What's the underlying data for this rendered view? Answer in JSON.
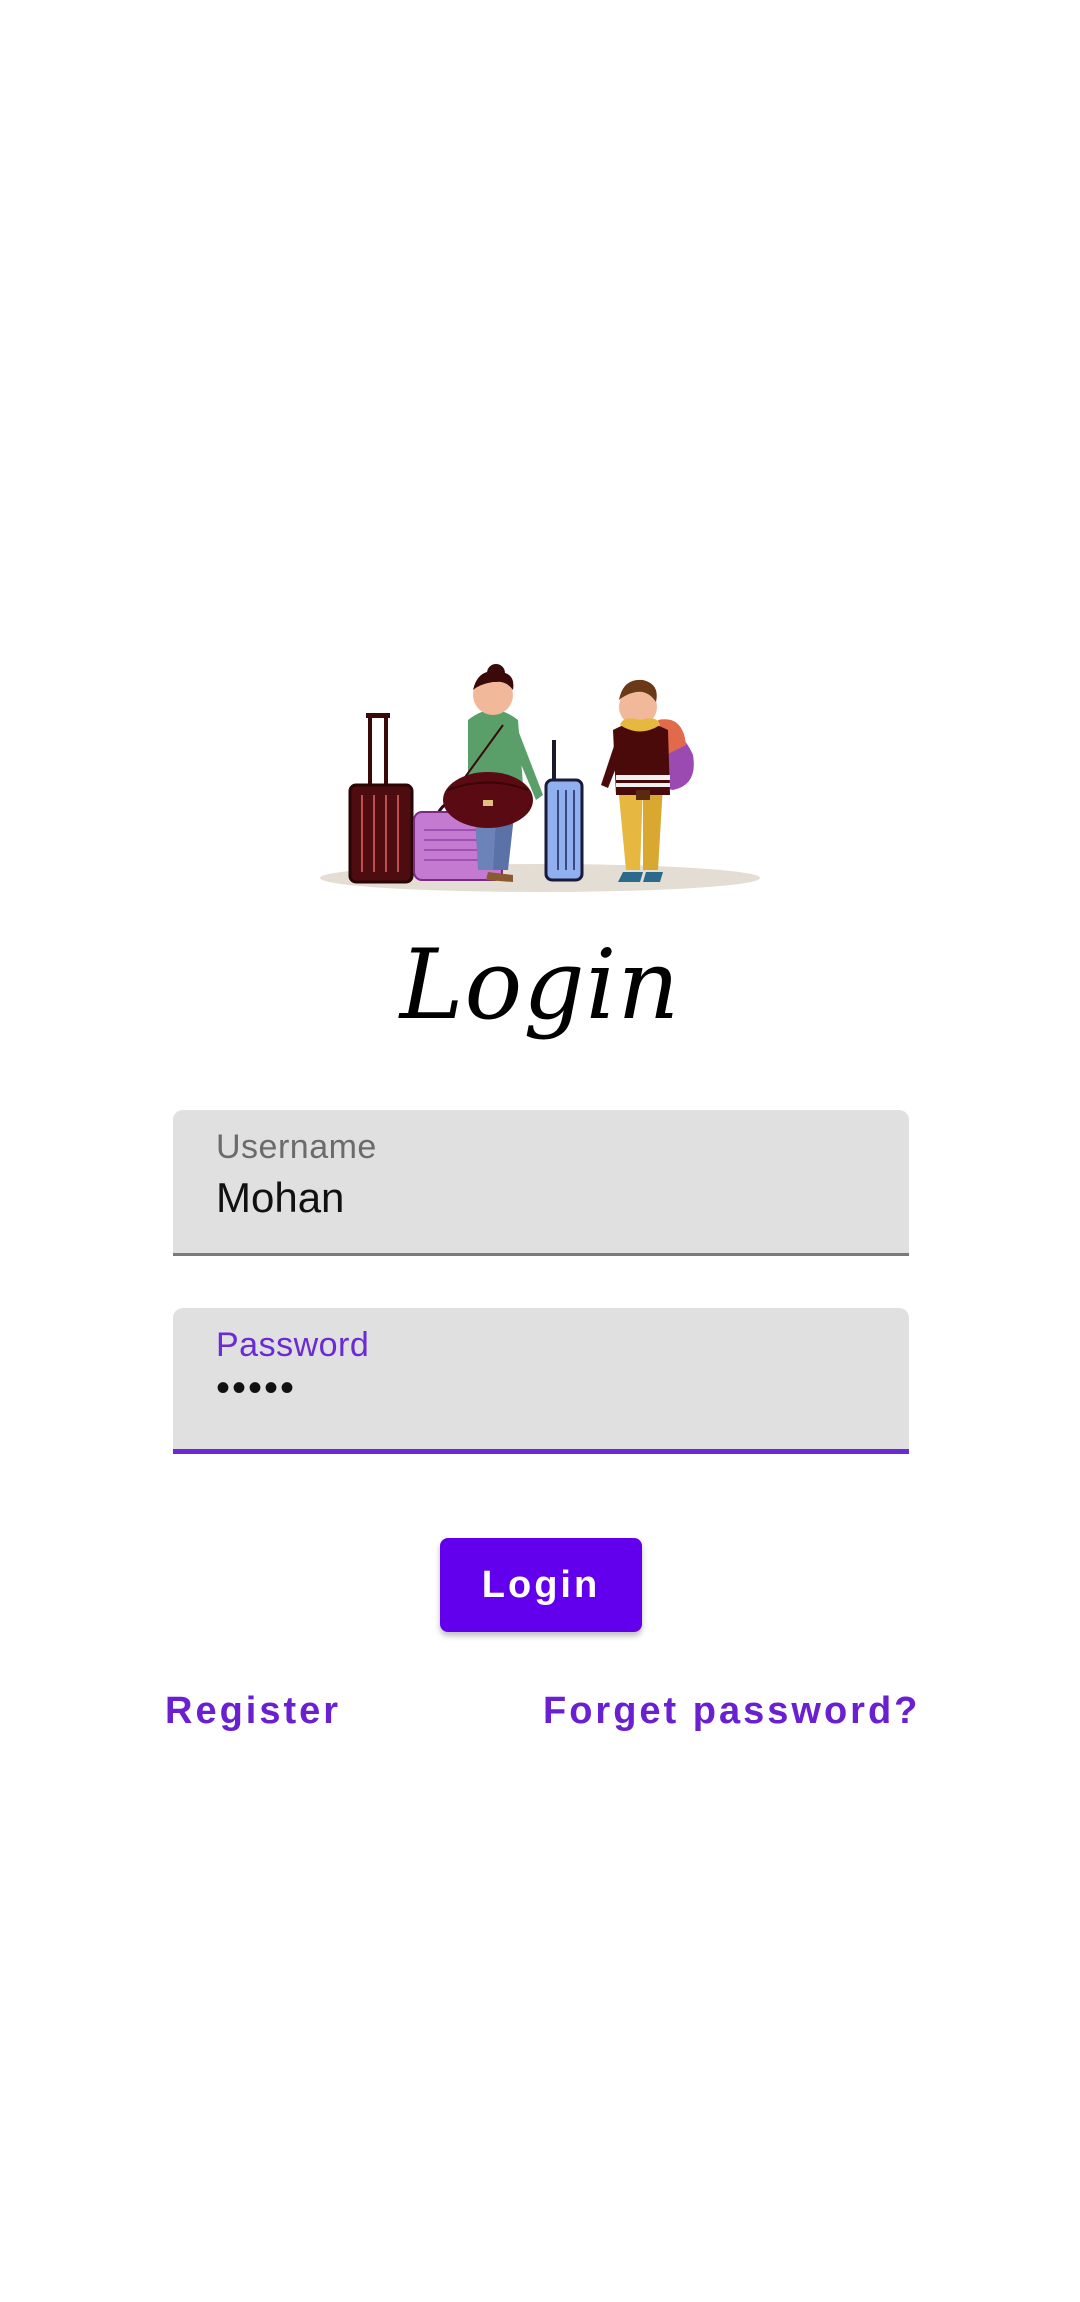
{
  "screen": {
    "title": "Login"
  },
  "form": {
    "username": {
      "label": "Username",
      "value": "Mohan"
    },
    "password": {
      "label": "Password",
      "value": "•••••"
    }
  },
  "actions": {
    "login_label": "Login",
    "register_label": "Register",
    "forgot_label": "Forget password?"
  },
  "colors": {
    "accent": "#6200ee",
    "link": "#6a1fd0",
    "field_bg": "#e0e0e0"
  },
  "icons": {
    "illustration": "travelers-with-luggage-illustration"
  }
}
